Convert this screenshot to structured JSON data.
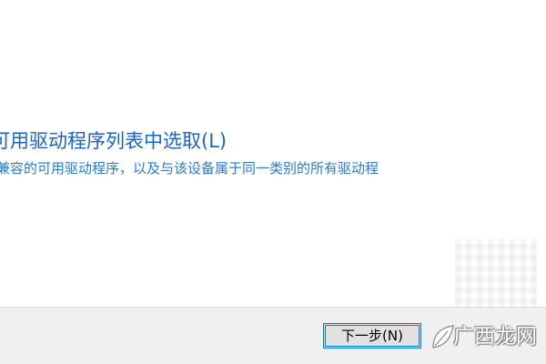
{
  "driver_option": {
    "link_label": "可用驱动程序列表中选取(L)",
    "description": "兼容的可用驱动程序，以及与该设备属于同一类别的所有驱动程"
  },
  "footer": {
    "next_label": "下一步(N)"
  },
  "watermark": {
    "text": "广西龙网",
    "icon": "leaf-logo-icon"
  },
  "colors": {
    "link": "#1a64c8",
    "description": "#2a7ad2",
    "footer_bg": "#f0f0f0",
    "button_focus": "#0078d7"
  }
}
